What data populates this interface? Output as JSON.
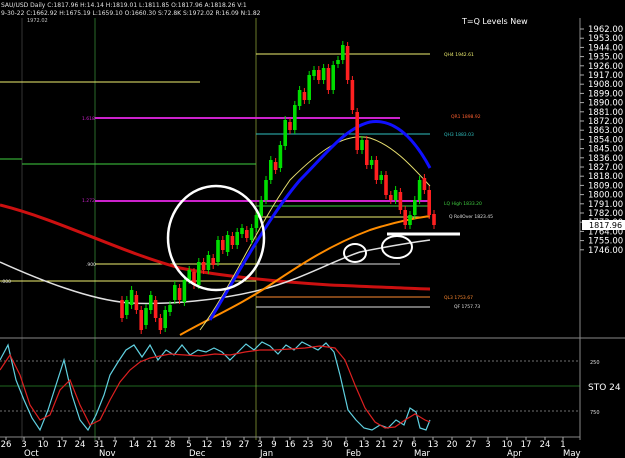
{
  "header": {
    "quote_line": "SAU/USD  Daily  C:1817.96  H:14.14  H:1819.01  L:1811.85  O:1817.96  A:1818.26  V:1",
    "sub_line": "9-30-22  C:1662.92  H:1675.19  L:1659.10  O:1660.30  S:72.8K  S:1972.02  R:16.09  N:1.82",
    "chart_tag": "1972.02"
  },
  "title": "T=Q Levels New",
  "price_axis": {
    "ticks": [
      "1962.00",
      "1953.00",
      "1944.00",
      "1935.00",
      "1926.00",
      "1917.00",
      "1908.00",
      "1899.00",
      "1890.00",
      "1881.00",
      "1872.00",
      "1863.00",
      "1854.00",
      "1845.00",
      "1836.00",
      "1827.00",
      "1818.00",
      "1809.00",
      "1800.00",
      "1791.00",
      "1782.00",
      "1773.00",
      "1764.00",
      "1755.00",
      "1746.00"
    ],
    "current_price": "1817.96"
  },
  "annotations": {
    "qh4": "QH4 1942.61",
    "qr1": "QR1 1898.92",
    "qh3": "QH3 1883.03",
    "lq_high": "LQ High 1833.20",
    "q_rollover": "Q RollOver 1823.45",
    "ql3": "QL3 1753.67",
    "qf": "QF 1757.73",
    "fib_1618": "1.618",
    "fib_1272": "1.272",
    "fib_900": ".900",
    "fib_000": ".000"
  },
  "oscillator": {
    "label": "STO 24",
    "level_high": "250",
    "level_low": "750"
  },
  "date_axis": {
    "days": [
      "26",
      "3",
      "10",
      "17",
      "24",
      "31",
      "7",
      "14",
      "21",
      "28",
      "5",
      "12",
      "19",
      "27",
      "3",
      "9",
      "16",
      "23",
      "30",
      "6",
      "13",
      "21",
      "27",
      "6",
      "13",
      "20",
      "27",
      "3",
      "10",
      "17",
      "24",
      "1"
    ],
    "months": [
      "Oct",
      "Nov",
      "Dec",
      "Jan",
      "Feb",
      "Mar",
      "Apr",
      "May"
    ]
  },
  "colors": {
    "background": "#000000",
    "candle_up": "#00dd00",
    "candle_down": "#ff2020",
    "ma_blue": "#1010ff",
    "ma_yellow": "#e8e070",
    "ma_orange": "#ff8c00",
    "ma_white": "#e0e0e0",
    "ma_red": "#cc1010",
    "level_yellow": "#f0f070",
    "level_magenta": "#cc22cc",
    "level_cyan": "#30c0c0",
    "level_orange": "#ff8a30",
    "level_green": "#40d040",
    "stoch_cyan": "#60d0e0",
    "stoch_red": "#dd2020"
  }
}
